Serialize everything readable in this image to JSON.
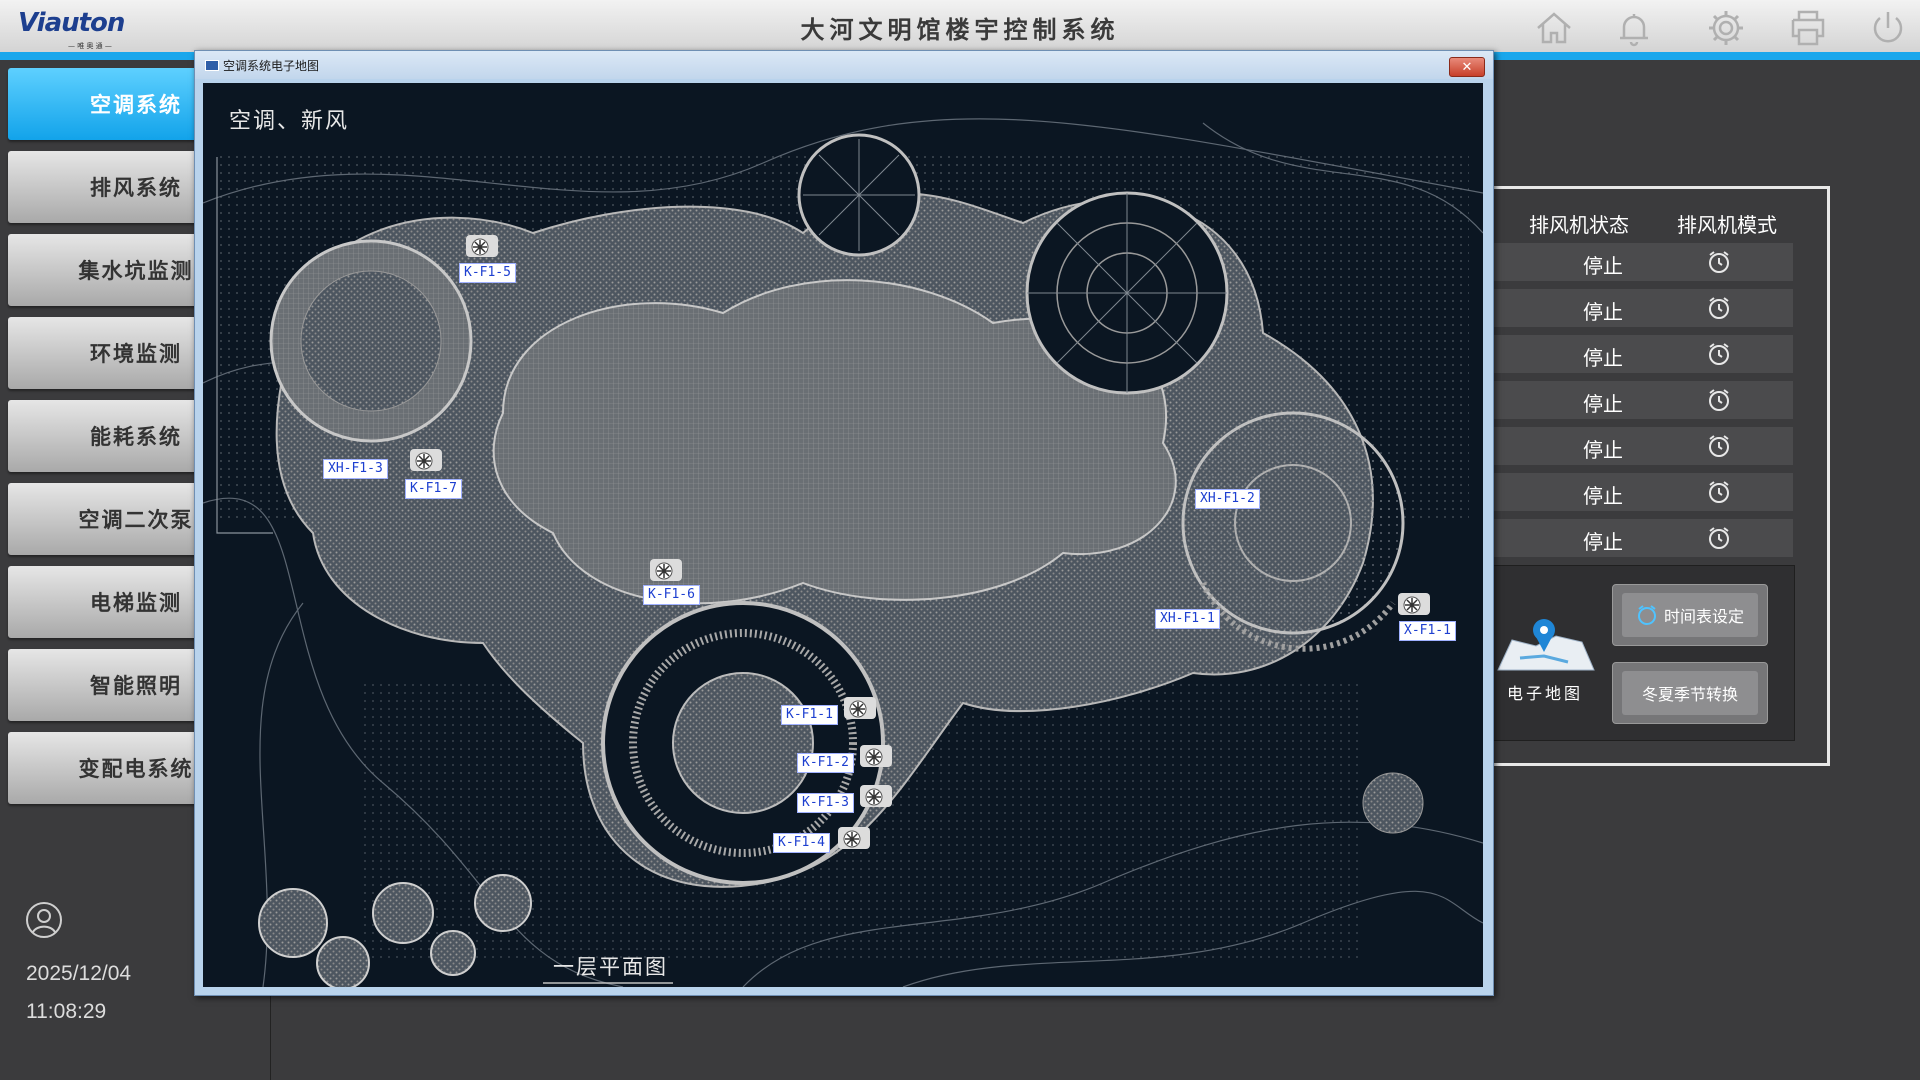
{
  "header": {
    "logo_text": "Viauton",
    "logo_sub": "— 唯 奥 通 —",
    "title": "大河文明馆楼宇控制系统"
  },
  "icons": {
    "home": "home-icon",
    "bell": "bell-icon",
    "settings": "gear-icon",
    "print": "printer-icon",
    "power": "power-icon"
  },
  "sidebar": {
    "items": [
      {
        "label": "空调系统",
        "active": true
      },
      {
        "label": "排风系统"
      },
      {
        "label": "集水坑监测"
      },
      {
        "label": "环境监测"
      },
      {
        "label": "能耗系统"
      },
      {
        "label": "空调二次泵"
      },
      {
        "label": "电梯监测"
      },
      {
        "label": "智能照明"
      },
      {
        "label": "变配电系统"
      }
    ],
    "date": "2025/12/04",
    "time": "11:08:29"
  },
  "exhaust_panel": {
    "col_status": "排风机状态",
    "col_mode": "排风机模式",
    "rows": [
      "停止",
      "停止",
      "停止",
      "停止",
      "停止",
      "停止",
      "停止"
    ],
    "map_label": "电子地图",
    "btn_schedule": "时间表设定",
    "btn_season": "冬夏季节转换"
  },
  "modal": {
    "title": "空调系统电子地图",
    "close": "✕",
    "heading": "空调、新风",
    "floor_label": "一层平面图",
    "fans": [
      "K-F1-5",
      "XH-F1-3",
      "K-F1-7",
      "K-F1-6",
      "XH-F1-2",
      "XH-F1-1",
      "X-F1-1",
      "K-F1-1",
      "K-F1-2",
      "K-F1-3",
      "K-F1-4"
    ]
  },
  "colors": {
    "accent": "#1aa7ec",
    "active_nav": "#12a3ea",
    "map_bg": "#0b1622",
    "fan_label_text": "#1d3fd0"
  }
}
